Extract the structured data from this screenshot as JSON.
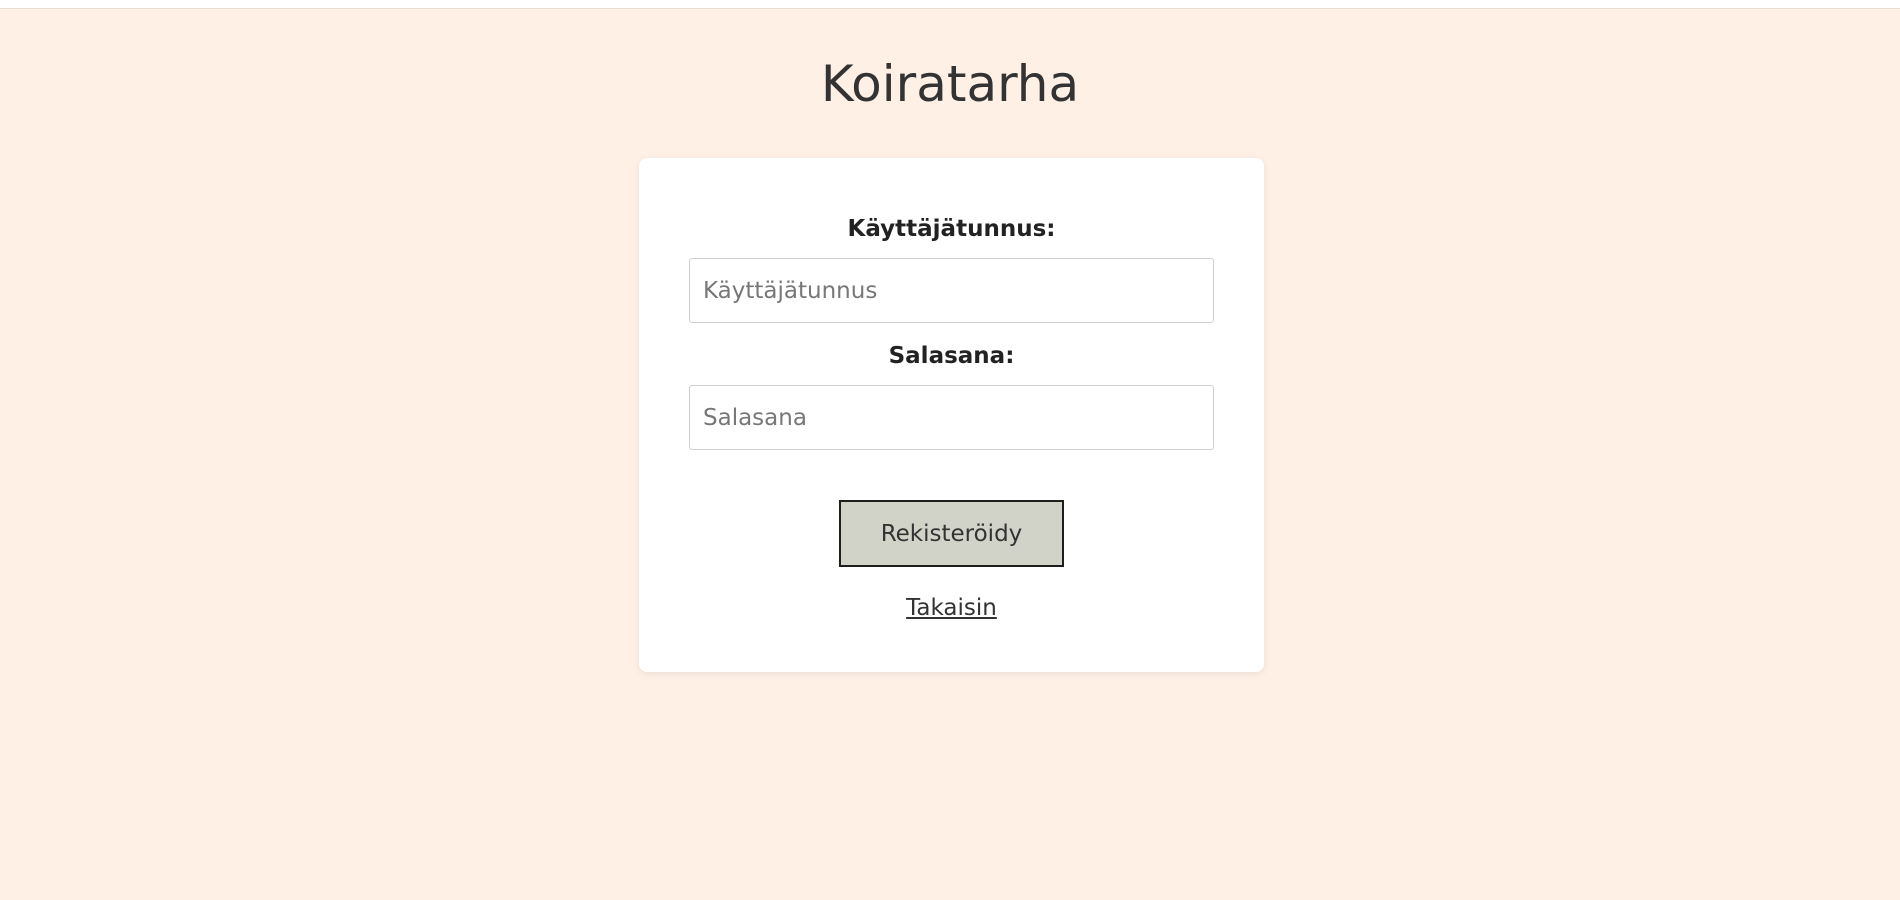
{
  "app": {
    "title": "Koiratarha"
  },
  "form": {
    "username_label": "Käyttäjätunnus:",
    "username_placeholder": "Käyttäjätunnus",
    "username_value": "",
    "password_label": "Salasana:",
    "password_placeholder": "Salasana",
    "password_value": "",
    "submit_label": "Rekisteröidy",
    "back_link_label": "Takaisin"
  },
  "colors": {
    "page_background": "#fff0e6",
    "card_background": "#ffffff",
    "button_background": "#d2d3c8",
    "text": "#333333"
  }
}
